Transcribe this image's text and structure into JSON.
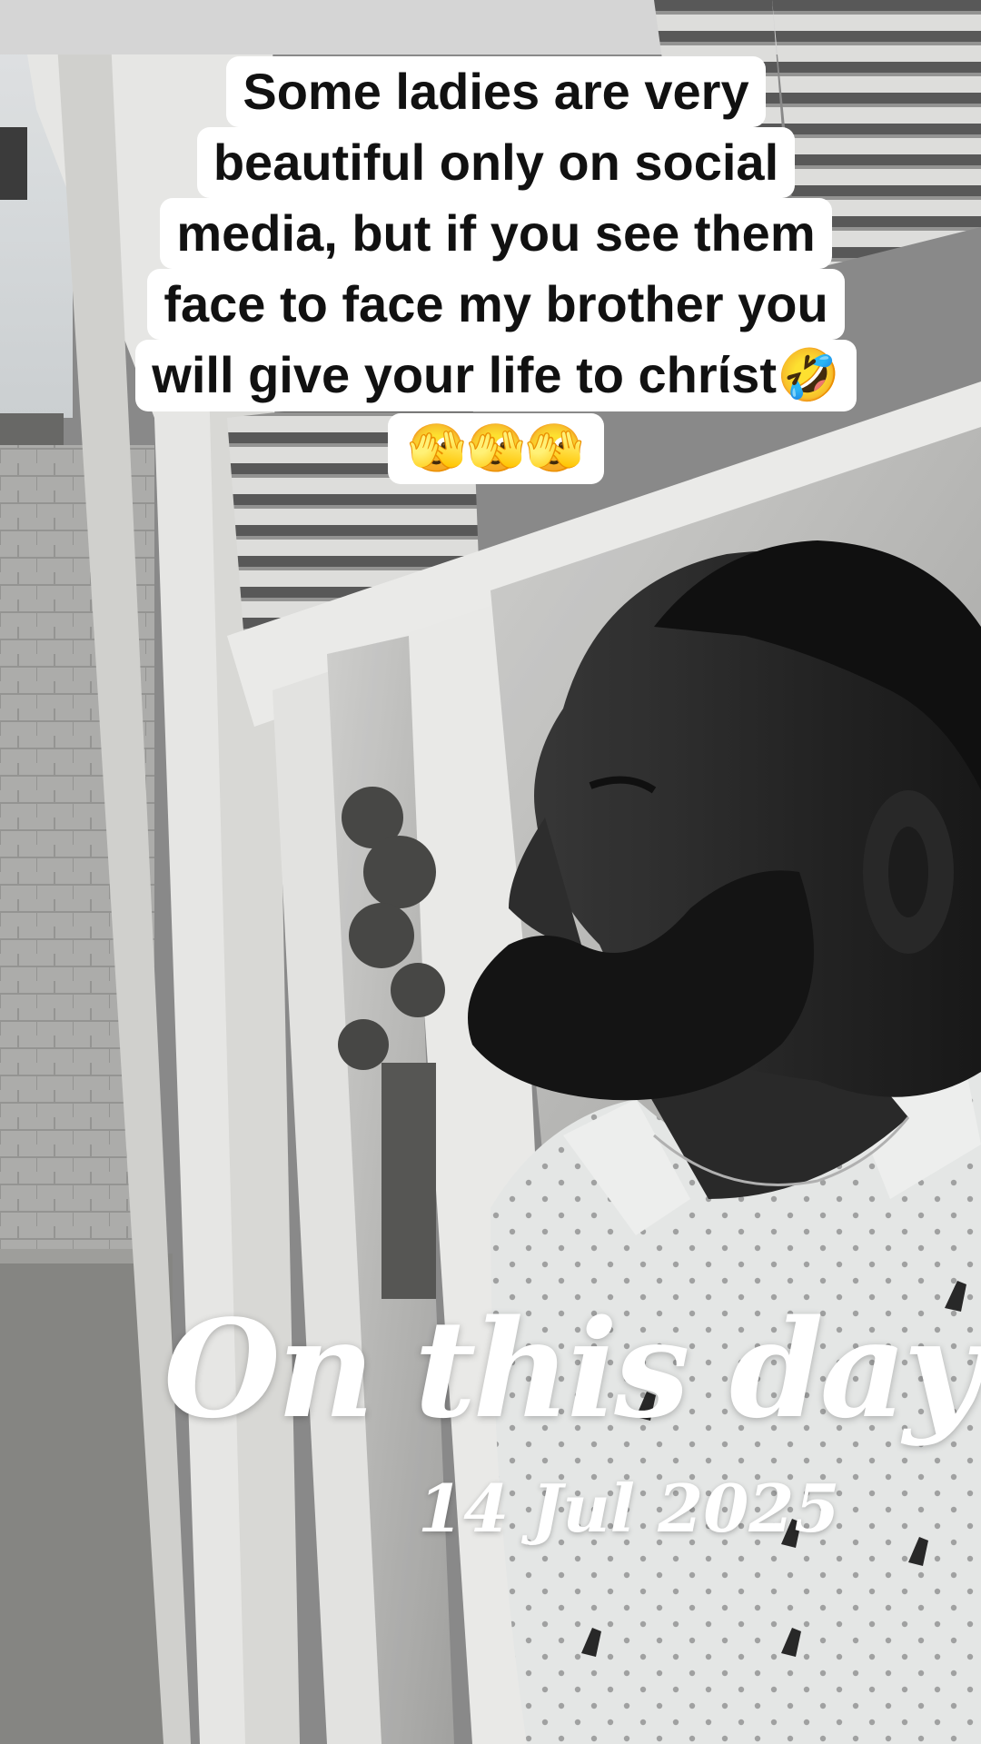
{
  "caption": {
    "lines": [
      "Some ladies are very",
      "beautiful only on social",
      "media, but if you see them",
      "face to face my brother you",
      "will give your life to chrίst"
    ],
    "trailing_emoji": "🤣",
    "emoji_row": "🫣🫣🫣"
  },
  "overlay": {
    "title": "On this day",
    "date": "14 Jul 2025"
  },
  "colors": {
    "caption_bg": "#ffffff",
    "caption_text": "#111111",
    "overlay_text": "#ffffff"
  }
}
